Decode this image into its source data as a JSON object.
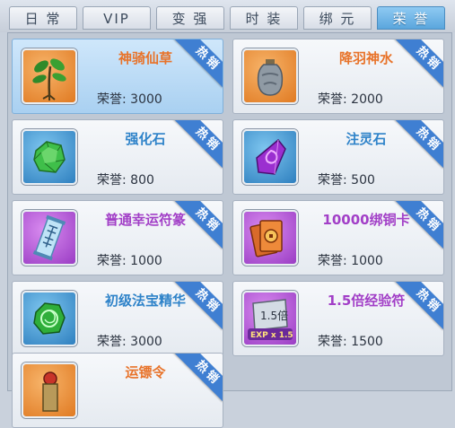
{
  "tabs": [
    {
      "label": "日 常"
    },
    {
      "label": "VIP"
    },
    {
      "label": "变 强"
    },
    {
      "label": "时 装"
    },
    {
      "label": "绑 元"
    },
    {
      "label": "荣 誉"
    }
  ],
  "active_tab": 5,
  "badge_label": "热销",
  "items": [
    {
      "name": "神骑仙草",
      "price": "荣誉: 3000",
      "name_color": "#e8732a",
      "icon": "herb-icon"
    },
    {
      "name": "降羽神水",
      "price": "荣誉: 2000",
      "name_color": "#e8732a",
      "icon": "potion-jar-icon"
    },
    {
      "name": "强化石",
      "price": "荣誉: 800",
      "name_color": "#2f83c9",
      "icon": "green-gem-icon"
    },
    {
      "name": "注灵石",
      "price": "荣誉: 500",
      "name_color": "#2f83c9",
      "icon": "purple-crystal-icon"
    },
    {
      "name": "普通幸运符篆",
      "price": "荣誉: 1000",
      "name_color": "#a23fc7",
      "icon": "luck-scroll-icon"
    },
    {
      "name": "10000绑铜卡",
      "price": "荣誉: 1000",
      "name_color": "#a23fc7",
      "icon": "copper-cards-icon"
    },
    {
      "name": "初级法宝精华",
      "price": "荣誉: 3000",
      "name_color": "#2f83c9",
      "icon": "jade-orb-icon"
    },
    {
      "name": "1.5倍经验符",
      "price": "荣誉: 1500",
      "name_color": "#a23fc7",
      "icon": "exp-talisman-icon"
    },
    {
      "name": "运镖令",
      "price": "",
      "name_color": "#e8732a",
      "icon": "escort-token-icon"
    }
  ],
  "icon_texts": {
    "exp_top": "1.5倍",
    "exp_bottom": "EXP x 1.5"
  }
}
